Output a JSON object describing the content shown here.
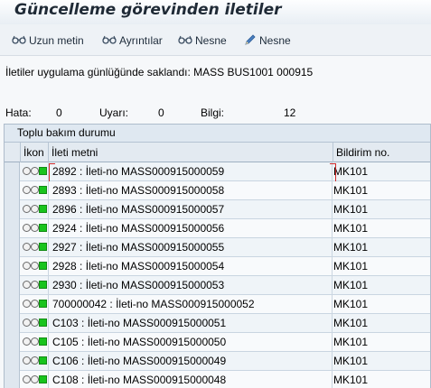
{
  "title": "Güncelleme görevinden iletiler",
  "toolbar": {
    "buttons": [
      {
        "label": "Uzun metin",
        "icon": "glasses-icon"
      },
      {
        "label": "Ayrıntılar",
        "icon": "glasses-icon"
      },
      {
        "label": "Nesne",
        "icon": "glasses-icon"
      },
      {
        "label": "Nesne",
        "icon": "pencil-icon"
      }
    ]
  },
  "info_message": "İletiler uygulama günlüğünde saklandı: MASS BUS1001 000915",
  "counts": {
    "error_label": "Hata:",
    "error_value": "0",
    "warning_label": "Uyarı:",
    "warning_value": "0",
    "info_label": "Bilgi:",
    "info_value": "12"
  },
  "panel": {
    "title": "Toplu bakım durumu",
    "columns": {
      "icon": "İkon",
      "text": "İleti metni",
      "number": "Bildirim no."
    },
    "rows": [
      {
        "text": "2892 : İleti-no MASS000915000059",
        "number": "MK101"
      },
      {
        "text": "2893 : İleti-no MASS000915000058",
        "number": "MK101"
      },
      {
        "text": "2896 : İleti-no MASS000915000057",
        "number": "MK101"
      },
      {
        "text": "2924 : İleti-no MASS000915000056",
        "number": "MK101"
      },
      {
        "text": "2927 : İleti-no MASS000915000055",
        "number": "MK101"
      },
      {
        "text": "2928 : İleti-no MASS000915000054",
        "number": "MK101"
      },
      {
        "text": "2930 : İleti-no MASS000915000053",
        "number": "MK101"
      },
      {
        "text": "700000042 : İleti-no MASS000915000052",
        "number": "MK101"
      },
      {
        "text": "C103 : İleti-no MASS000915000051",
        "number": "MK101"
      },
      {
        "text": "C105 : İleti-no MASS000915000050",
        "number": "MK101"
      },
      {
        "text": "C106 : İleti-no MASS000915000049",
        "number": "MK101"
      },
      {
        "text": "C108 : İleti-no MASS000915000048",
        "number": "MK101"
      }
    ]
  },
  "colors": {
    "status_green": "#19c41d",
    "accent_blue": "#1d5fa8",
    "focus_red": "#d12b2b"
  }
}
